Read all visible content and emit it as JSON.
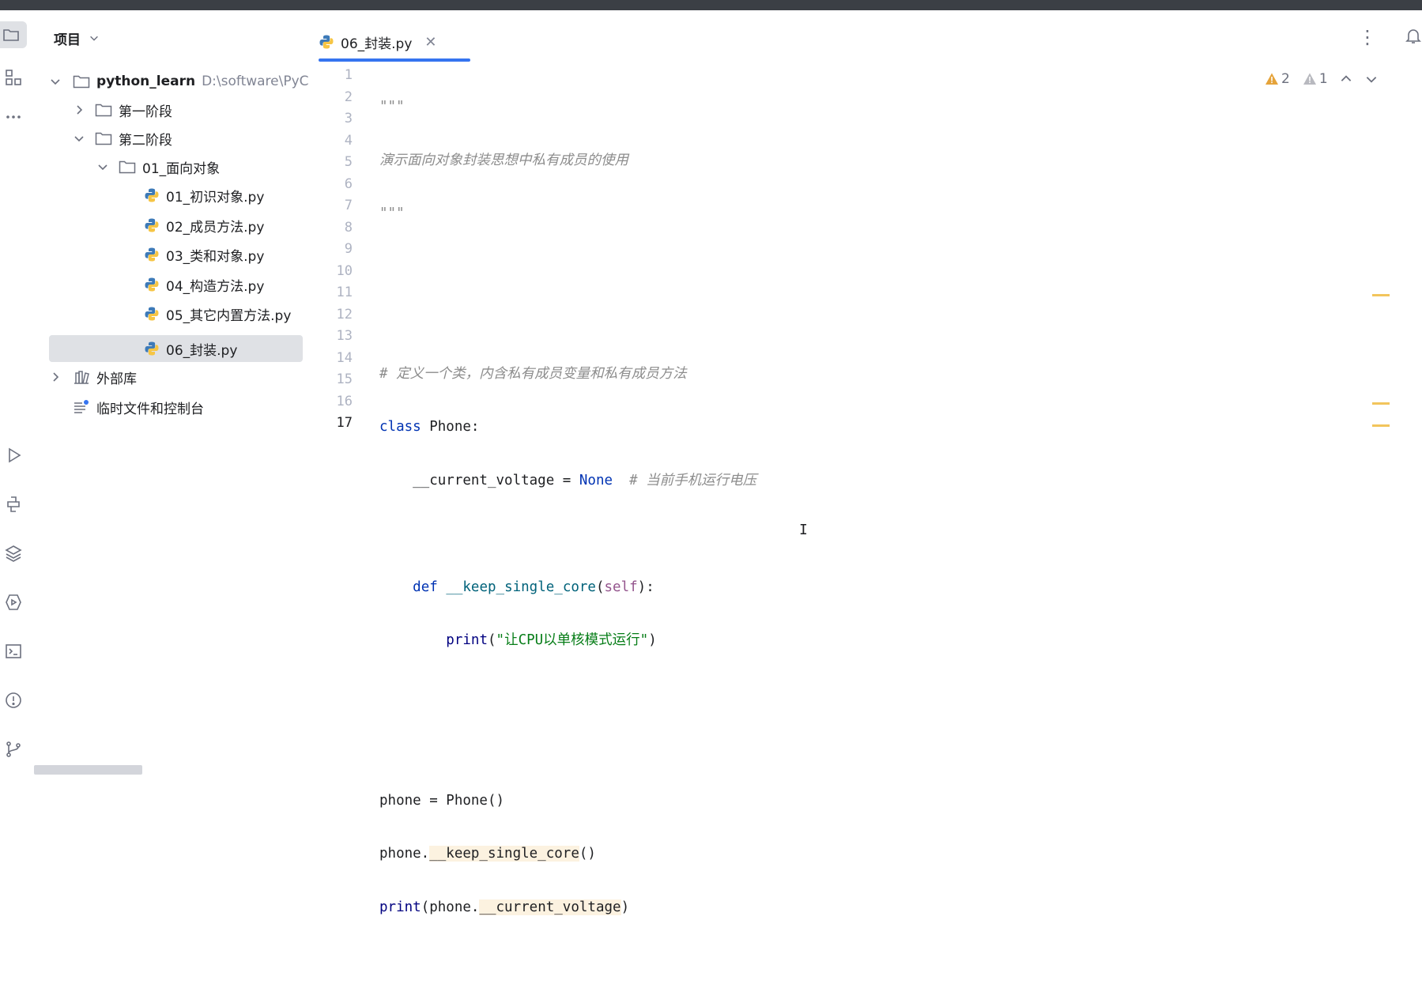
{
  "project_panel": {
    "title": "项目",
    "tree": [
      {
        "label": "python_learn",
        "path_hint": "D:\\software\\PyC",
        "type": "folder",
        "expanded": true,
        "depth": 0
      },
      {
        "label": "第一阶段",
        "type": "folder",
        "expanded": false,
        "depth": 1
      },
      {
        "label": "第二阶段",
        "type": "folder",
        "expanded": true,
        "depth": 1
      },
      {
        "label": "01_面向对象",
        "type": "folder",
        "expanded": true,
        "depth": 2
      },
      {
        "label": "01_初识对象.py",
        "type": "python",
        "depth": 3
      },
      {
        "label": "02_成员方法.py",
        "type": "python",
        "depth": 3
      },
      {
        "label": "03_类和对象.py",
        "type": "python",
        "depth": 3
      },
      {
        "label": "04_构造方法.py",
        "type": "python",
        "depth": 3
      },
      {
        "label": "05_其它内置方法.py",
        "type": "python",
        "depth": 3
      },
      {
        "label": "06_封装.py",
        "type": "python",
        "depth": 3,
        "selected": true
      },
      {
        "label": "外部库",
        "type": "library",
        "expanded": false,
        "depth": 0
      },
      {
        "label": "临时文件和控制台",
        "type": "scratch",
        "depth": 0
      }
    ]
  },
  "editor": {
    "tab_label": "06_封装.py",
    "line_numbers": [
      "1",
      "2",
      "3",
      "4",
      "5",
      "6",
      "7",
      "8",
      "9",
      "10",
      "11",
      "12",
      "13",
      "14",
      "15",
      "16",
      "17"
    ],
    "current_line": "17",
    "inspections": {
      "warnings": "2",
      "weak_warnings": "1"
    }
  },
  "code": {
    "l1": "\"\"\"",
    "l2": "演示面向对象封装思想中私有成员的使用",
    "l3": "\"\"\"",
    "l6": "# 定义一个类，内含私有成员变量和私有成员方法",
    "l7_kw": "class",
    "l7_rest": " Phone:",
    "l8_a": "    __current_voltage = ",
    "l8_none": "None",
    "l8_cm": "  # 当前手机运行电压",
    "l10_ind": "    ",
    "l10_kw": "def",
    "l10_sp": " ",
    "l10_fn": "__keep_single_core",
    "l10_p1": "(",
    "l10_self": "self",
    "l10_p2": "):",
    "l11_ind": "        ",
    "l11_print": "print",
    "l11_p1": "(",
    "l11_str": "\"让CPU以单核模式运行\"",
    "l11_p2": ")",
    "l14": "phone = Phone()",
    "l15_a": "phone.",
    "l15_hl": "__keep_single_core",
    "l15_b": "()",
    "l16_print": "print",
    "l16_a": "(phone.",
    "l16_hl": "__current_voltage",
    "l16_b": ")"
  },
  "colors": {
    "keyword": "#0033b3",
    "function": "#00627a",
    "string": "#067d17",
    "comment": "#8c8c8c",
    "self": "#94558d",
    "warning": "#f2c55c",
    "accent": "#3574f0"
  }
}
